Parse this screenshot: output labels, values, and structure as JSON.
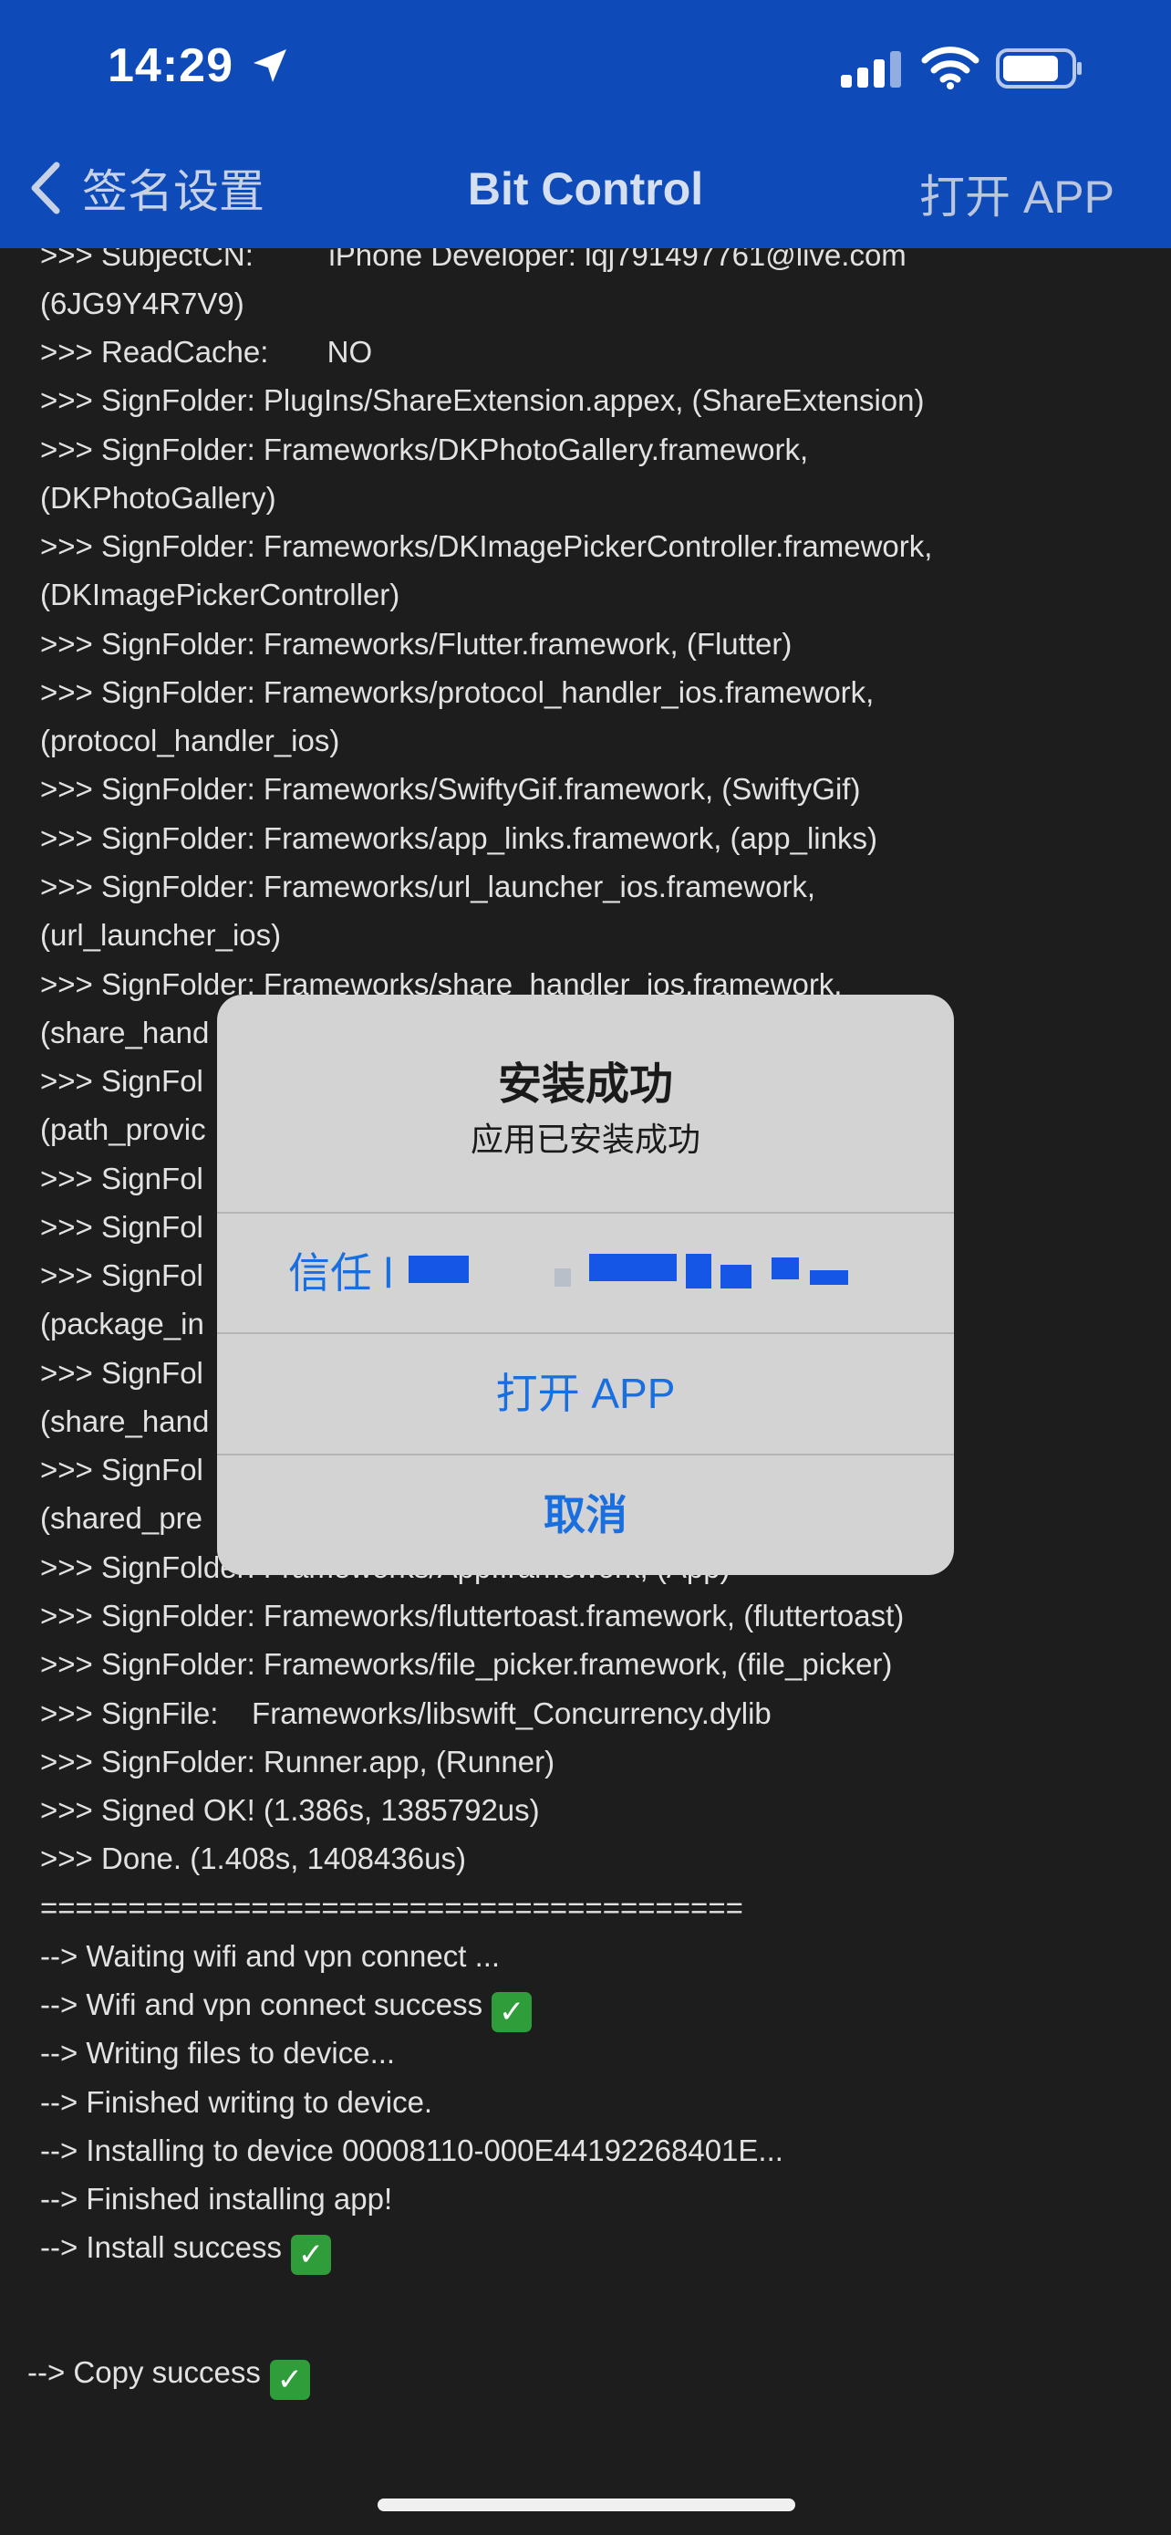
{
  "status_bar": {
    "time": "14:29"
  },
  "nav": {
    "back_label": "签名设置",
    "title": "Bit Control",
    "right_label": "打开 APP"
  },
  "log_lines": [
    ">>> SubjectCN:         iPhone Developer: lqj791497761@live.com",
    "(6JG9Y4R7V9)",
    ">>> ReadCache:       NO",
    ">>> SignFolder: PlugIns/ShareExtension.appex, (ShareExtension)",
    ">>> SignFolder: Frameworks/DKPhotoGallery.framework,",
    "(DKPhotoGallery)",
    ">>> SignFolder: Frameworks/DKImagePickerController.framework,",
    "(DKImagePickerController)",
    ">>> SignFolder: Frameworks/Flutter.framework, (Flutter)",
    ">>> SignFolder: Frameworks/protocol_handler_ios.framework,",
    "(protocol_handler_ios)",
    ">>> SignFolder: Frameworks/SwiftyGif.framework, (SwiftyGif)",
    ">>> SignFolder: Frameworks/app_links.framework, (app_links)",
    ">>> SignFolder: Frameworks/url_launcher_ios.framework,",
    "(url_launcher_ios)",
    ">>> SignFolder: Frameworks/share_handler_ios.framework,",
    "(share_hand",
    ">>> SignFol                                                              work,",
    "(path_provic",
    ">>> SignFol                                                              ebImage)",
    ">>> SignFol                                                              us)",
    ">>> SignFol",
    "(package_in",
    ">>> SignFol                                                              ework,",
    "(share_hand",
    ">>> SignFol                                                              ramework,",
    "(shared_pre",
    ">>> SignFolder: Frameworks/App.framework, (App)",
    ">>> SignFolder: Frameworks/fluttertoast.framework, (fluttertoast)",
    ">>> SignFolder: Frameworks/file_picker.framework, (file_picker)",
    ">>> SignFile:    Frameworks/libswift_Concurrency.dylib",
    ">>> SignFolder: Runner.app, (Runner)",
    ">>> Signed OK! (1.386s, 1385792us)",
    ">>> Done. (1.408s, 1408436us)",
    "========================================",
    "--> Waiting wifi and vpn connect ...",
    "--> Wifi and vpn connect success",
    "--> Writing files to device...",
    "--> Finished writing to device.",
    "--> Installing to device 00008110-000E44192268401E...",
    "--> Finished installing app!",
    "--> Install success"
  ],
  "copy_line": "--> Copy success",
  "check_glyph": "✓",
  "alert": {
    "title": "安装成功",
    "message": "应用已安装成功",
    "trust_label": "信任 l",
    "open_label": "打开 APP",
    "cancel_label": "取消"
  },
  "colors": {
    "nav_bg": "#0e4bb8",
    "log_bg": "#1d1d1d",
    "alert_bg": "#d3d3d3",
    "alert_button": "#1a6fe0",
    "check_bg": "#2e9d3a"
  }
}
